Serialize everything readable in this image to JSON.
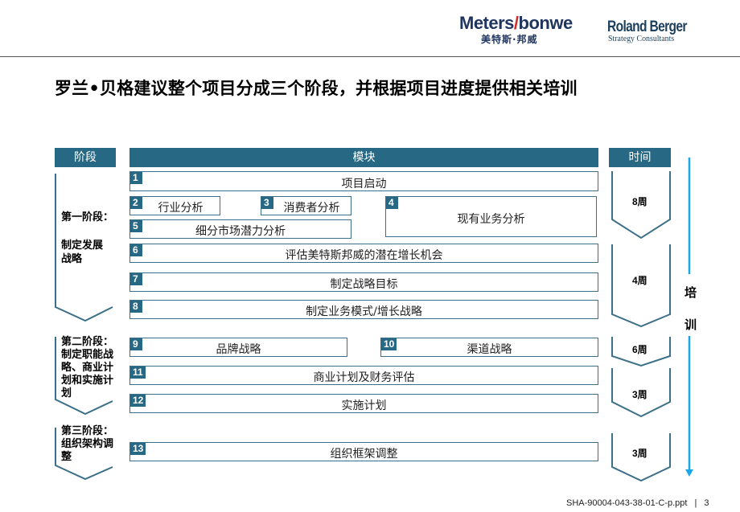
{
  "header": {
    "logo_metersbonwe": {
      "part1": "Meters",
      "slash": "/",
      "part2": "bonwe",
      "chinese": "美特斯·邦威"
    },
    "logo_rolandberger": {
      "name": "Roland Berger",
      "subtitle": "Strategy Consultants"
    }
  },
  "title": "罗兰•贝格建议整个项目分成三个阶段，并根据项目进度提供相关培训",
  "columns": {
    "stage": "阶段",
    "module": "模块",
    "time": "时间"
  },
  "stages": [
    {
      "title": "第一阶段：",
      "subtitle": "制定发展\n战略"
    },
    {
      "title": "第二阶段：",
      "subtitle": "制定职能战略、商业计划和实施计划"
    },
    {
      "title": "第三阶段：",
      "subtitle": "组织架构调整"
    }
  ],
  "stage_lines": {
    "s1": [
      "第一阶段："
    ],
    "s1b": [
      "制定发展",
      "战略"
    ],
    "s2": [
      "第二阶段：",
      "制定职能战",
      "略、商业计",
      "划和实施计",
      "划"
    ],
    "s3": [
      "第三阶段：",
      "组织架构调",
      "整"
    ]
  },
  "modules": [
    {
      "num": "1",
      "label": "项目启动"
    },
    {
      "num": "2",
      "label": "行业分析"
    },
    {
      "num": "3",
      "label": "消费者分析"
    },
    {
      "num": "4",
      "label": "现有业务分析"
    },
    {
      "num": "5",
      "label": "细分市场潜力分析"
    },
    {
      "num": "6",
      "label": "评估美特斯邦威的潜在增长机会"
    },
    {
      "num": "7",
      "label": "制定战略目标"
    },
    {
      "num": "8",
      "label": "制定业务模式/增长战略"
    },
    {
      "num": "9",
      "label": "品牌战略"
    },
    {
      "num": "10",
      "label": "渠道战略"
    },
    {
      "num": "11",
      "label": "商业计划及财务评估"
    },
    {
      "num": "12",
      "label": "实施计划"
    },
    {
      "num": "13",
      "label": "组织框架调整"
    }
  ],
  "durations": [
    "8周",
    "4周",
    "6周",
    "3周",
    "3周"
  ],
  "training": {
    "chars": [
      "培",
      "训"
    ],
    "color": "#1aa7e8"
  },
  "colors": {
    "accent": "#276985",
    "outline": "#3c6f88"
  },
  "footer": {
    "doc_id": "SHA-90004-043-38-01-C-p.ppt",
    "separator": "|",
    "page": "3"
  }
}
